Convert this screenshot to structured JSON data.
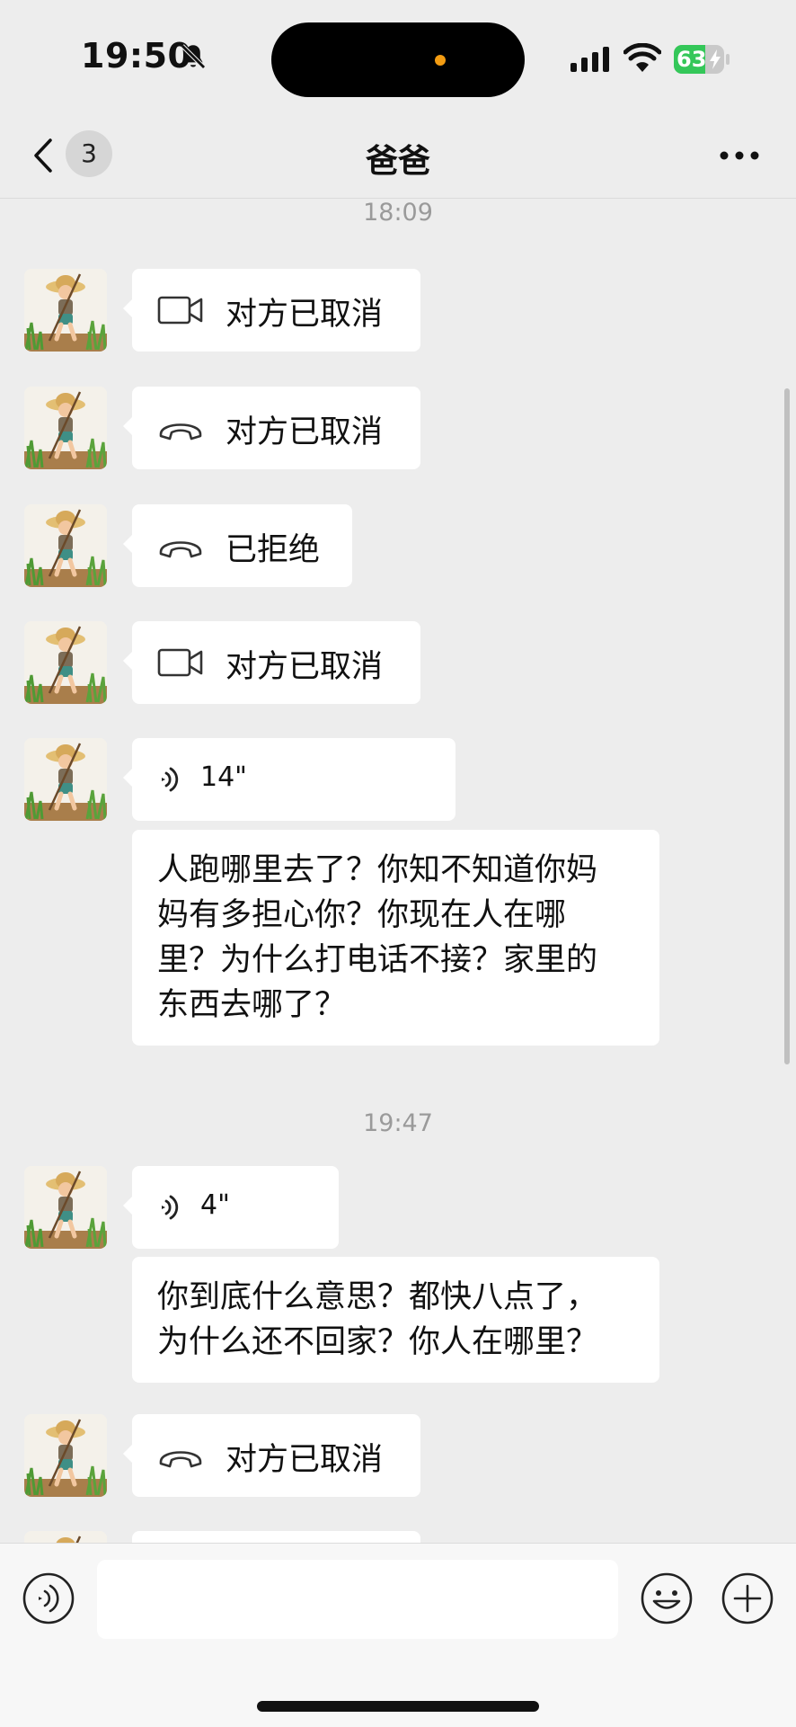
{
  "status_bar": {
    "time": "19:50",
    "battery_level": "63",
    "battery_percent": 63,
    "battery_color": "#34c759",
    "island_dot_color": "#f39c12",
    "icons": [
      "bell-muted-icon",
      "signal-icon",
      "wifi-icon",
      "battery-icon"
    ]
  },
  "nav": {
    "back_badge": "3",
    "title": "爸爸",
    "icons": [
      "chevron-left-icon",
      "more-icon"
    ]
  },
  "chat": {
    "separators": [
      "18:09",
      "19:47"
    ],
    "messages": [
      {
        "type": "call",
        "icon": "video-call-icon",
        "text": "对方已取消"
      },
      {
        "type": "call",
        "icon": "phone-icon",
        "text": "对方已取消"
      },
      {
        "type": "call",
        "icon": "phone-icon",
        "text": "已拒绝"
      },
      {
        "type": "call",
        "icon": "video-call-icon",
        "text": "对方已取消"
      },
      {
        "type": "voice",
        "icon": "voice-wave-icon",
        "duration": "14\""
      },
      {
        "type": "text",
        "lines": [
          "人跑哪里去了？你知不知道你妈",
          "妈有多担心你？你现在人在哪",
          "里？为什么打电话不接？家里的",
          "东西去哪了？"
        ]
      },
      {
        "type": "voice",
        "icon": "voice-wave-icon",
        "duration": "4\""
      },
      {
        "type": "text",
        "lines": [
          "你到底什么意思？都快八点了，",
          "为什么还不回家？你人在哪里？"
        ]
      },
      {
        "type": "call",
        "icon": "phone-icon",
        "text": "对方已取消"
      }
    ]
  },
  "input_bar": {
    "value": "",
    "placeholder": "",
    "icons": [
      "voice-input-icon",
      "emoji-icon",
      "plus-icon"
    ]
  }
}
